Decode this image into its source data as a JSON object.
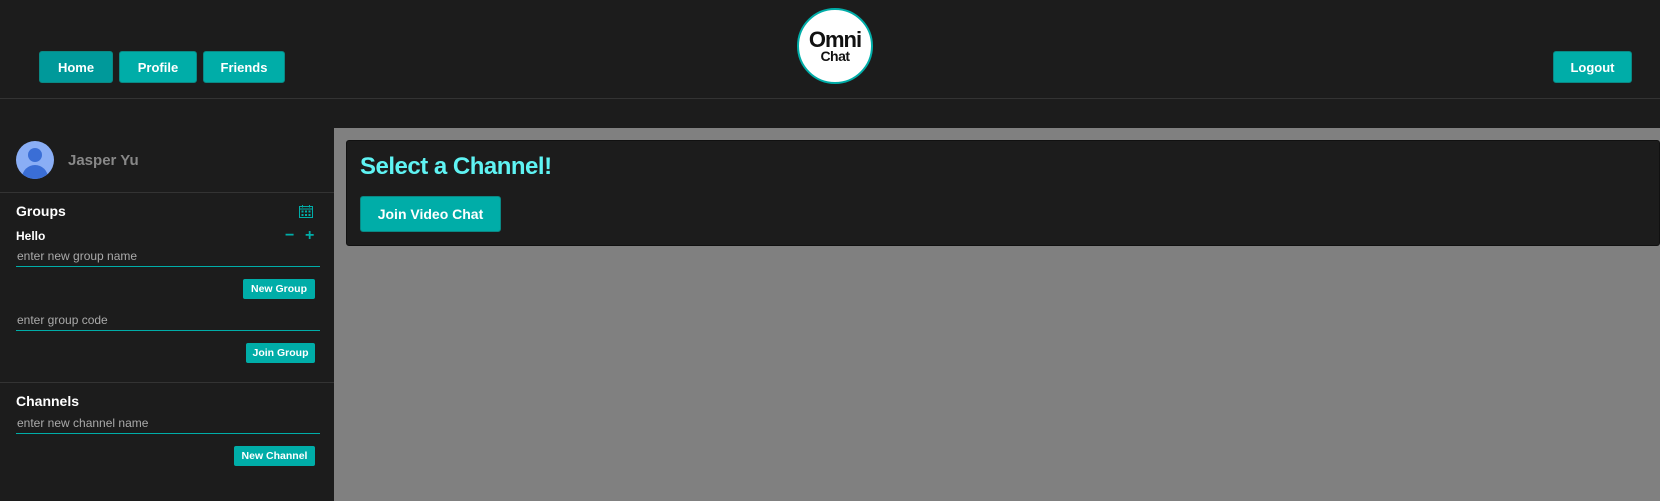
{
  "header": {
    "nav": {
      "home": "Home",
      "profile": "Profile",
      "friends": "Friends"
    },
    "logout": "Logout",
    "logo": {
      "line1": "Omni",
      "line2": "Chat"
    }
  },
  "sidebar": {
    "user": {
      "name": "Jasper Yu"
    },
    "groups": {
      "title": "Groups",
      "active_group": "Hello",
      "new_group_placeholder": "enter new group name",
      "new_group_button": "New Group",
      "group_code_placeholder": "enter group code",
      "join_group_button": "Join Group"
    },
    "channels": {
      "title": "Channels",
      "new_channel_placeholder": "enter new channel name",
      "new_channel_button": "New Channel"
    }
  },
  "main": {
    "title": "Select a Channel!",
    "join_video_button": "Join Video Chat"
  },
  "colors": {
    "accent": "#00ada8",
    "title": "#5ff3f3",
    "background": "#1c1c1c",
    "content_area": "#808080"
  },
  "icons": {
    "calendar": "calendar-icon",
    "minus": "minus-icon",
    "plus": "plus-icon",
    "avatar": "user-avatar-icon"
  }
}
